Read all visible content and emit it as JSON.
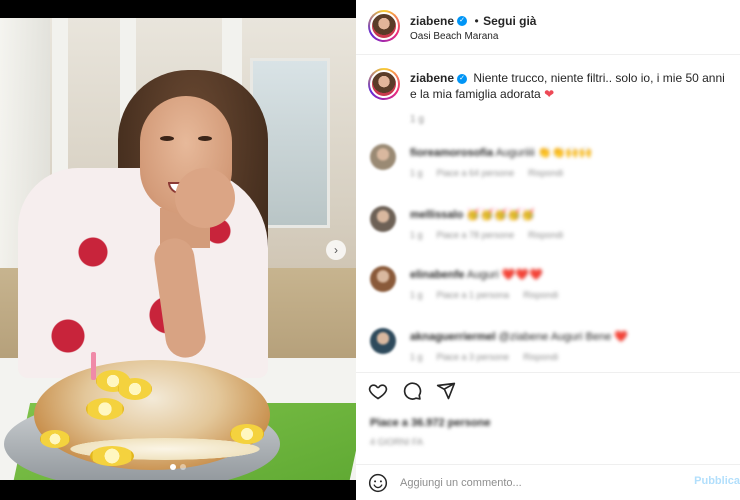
{
  "post": {
    "username": "ziabene",
    "follow_label": "Segui già",
    "location": "Oasi Beach Marana",
    "caption_username": "ziabene",
    "caption_text": "Niente trucco, niente filtri.. solo io, i mie 50 anni e la mia famiglia adorata",
    "caption_emoji": "❤",
    "caption_time": "1 g"
  },
  "comments": [
    {
      "username": "fioreamorosofia",
      "text": "Auguriiii 👏👏🙌🙌",
      "time": "1 g",
      "likes": "Piace a 64 persone",
      "reply": "Rispondi",
      "avatar_color": "#9a8a74"
    },
    {
      "username": "mellissalo",
      "text": "🥳🥳🥳🥳🥳",
      "time": "1 g",
      "likes": "Piace a 78 persone",
      "reply": "Rispondi",
      "avatar_color": "#6d6156"
    },
    {
      "username": "elinabenfe",
      "text": "Auguri ❤️❤️❤️",
      "time": "1 g",
      "likes": "Piace a 1 persona",
      "reply": "Rispondi",
      "avatar_color": "#8a5a3a"
    },
    {
      "username": "aknaguerriermel",
      "text": "@ziabene Auguri Bene ❤️",
      "time": "1 g",
      "likes": "Piace a 3 persone",
      "reply": "Rispondi",
      "avatar_color": "#2e4a5c"
    }
  ],
  "engagement": {
    "likes_text": "Piace a 36.972 persone",
    "date_text": "4 GIORNI FA"
  },
  "composer": {
    "placeholder": "Aggiungi un commento...",
    "post_label": "Pubblica"
  },
  "carousel": {
    "next_glyph": "›",
    "total_slides": 2,
    "active_slide": 1
  },
  "colors": {
    "verified": "#0095f6",
    "heart": "#ed4956",
    "post_disabled": "#b2dffc"
  }
}
